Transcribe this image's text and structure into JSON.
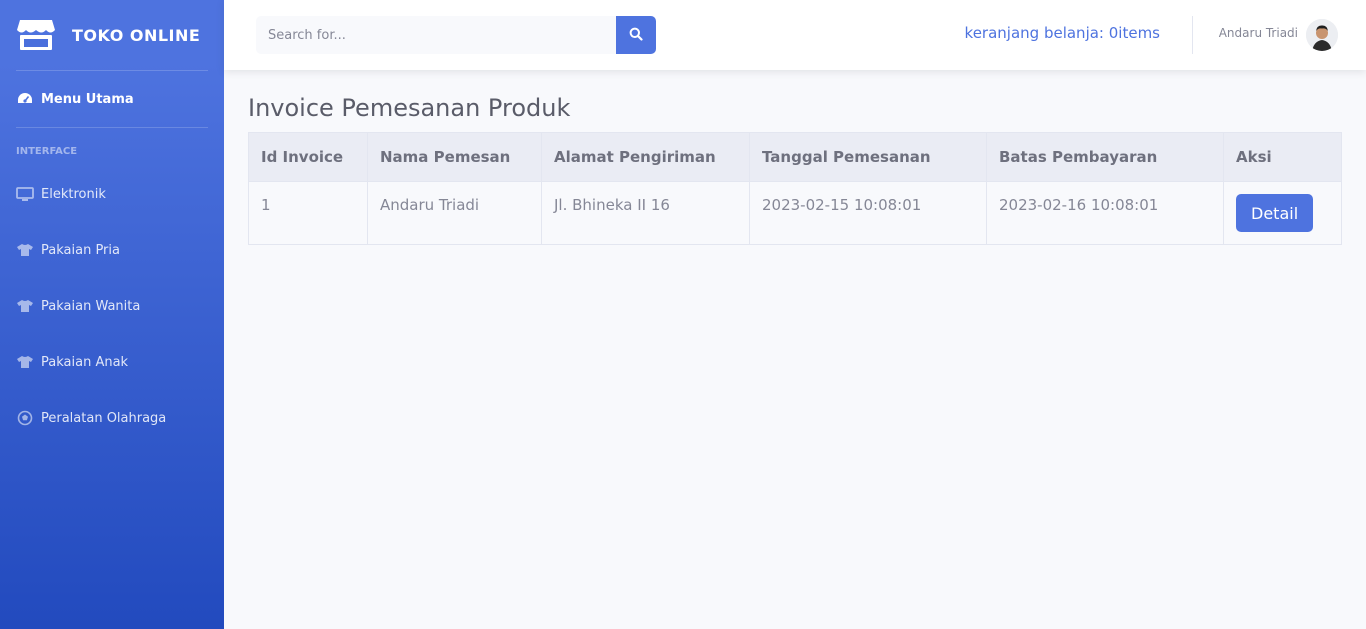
{
  "sidebar": {
    "brand": "TOKO ONLINE",
    "main_item": "Menu Utama",
    "heading": "INTERFACE",
    "items": [
      {
        "label": "Elektronik",
        "icon": "desktop-icon"
      },
      {
        "label": "Pakaian Pria",
        "icon": "tshirt-icon"
      },
      {
        "label": "Pakaian Wanita",
        "icon": "tshirt-icon"
      },
      {
        "label": "Pakaian Anak",
        "icon": "tshirt-icon"
      },
      {
        "label": "Peralatan Olahraga",
        "icon": "futbol-icon"
      }
    ]
  },
  "topbar": {
    "search_placeholder": "Search for...",
    "cart_text": "keranjang belanja: 0items",
    "user_name": "Andaru Triadi"
  },
  "page": {
    "title": "Invoice Pemesanan Produk"
  },
  "table": {
    "headers": [
      "Id Invoice",
      "Nama Pemesan",
      "Alamat Pengiriman",
      "Tanggal Pemesanan",
      "Batas Pembayaran",
      "Aksi"
    ],
    "rows": [
      {
        "id": "1",
        "name": "Andaru Triadi",
        "address": "Jl. Bhineka II 16",
        "order_date": "2023-02-15 10:08:01",
        "due_date": "2023-02-16 10:08:01",
        "action": "Detail"
      }
    ]
  },
  "colors": {
    "primary": "#4e73df",
    "sidebar_end": "#224abe",
    "text_muted": "#858796"
  }
}
